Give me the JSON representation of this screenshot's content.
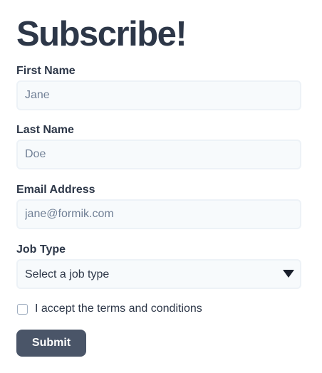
{
  "form": {
    "title": "Subscribe!",
    "first_name": {
      "label": "First Name",
      "placeholder": "Jane",
      "value": ""
    },
    "last_name": {
      "label": "Last Name",
      "placeholder": "Doe",
      "value": ""
    },
    "email": {
      "label": "Email Address",
      "placeholder": "jane@formik.com",
      "value": ""
    },
    "job_type": {
      "label": "Job Type",
      "selected": "Select a job type",
      "icon": "chevron-down-icon"
    },
    "terms": {
      "label": "I accept the terms and conditions",
      "checked": false
    },
    "submit_label": "Submit"
  },
  "colors": {
    "text": "#2d3748",
    "input_bg": "#f7fafc",
    "input_border": "#edf2f7",
    "button_bg": "#4a5568",
    "button_text": "#ffffff"
  }
}
